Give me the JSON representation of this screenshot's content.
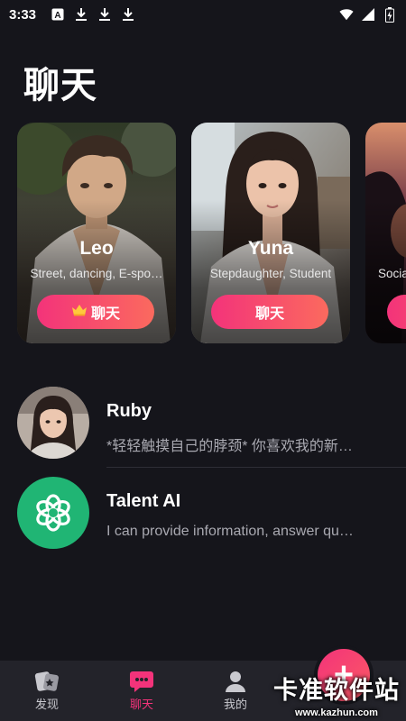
{
  "status_bar": {
    "time": "3:33",
    "left_icons": [
      "app-a-icon",
      "download-icon",
      "download-icon",
      "download-icon"
    ],
    "right_icons": [
      "wifi-icon",
      "signal-icon",
      "battery-icon"
    ]
  },
  "page_title": "聊天",
  "cards": [
    {
      "name": "Leo",
      "description": "Street, dancing, E-spo…",
      "button_label": "聊天",
      "button_icon": "crown-icon"
    },
    {
      "name": "Yuna",
      "description": "Stepdaughter, Student",
      "button_label": "聊天"
    },
    {
      "name": "",
      "description": "Socia",
      "button_label": ""
    }
  ],
  "chats": [
    {
      "name": "Ruby",
      "preview": "*轻轻触摸自己的脖颈* 你喜欢我的新…",
      "avatar": "portrait"
    },
    {
      "name": "Talent AI",
      "preview": "I can provide information, answer qu…",
      "avatar": "openai-logo-icon"
    }
  ],
  "bottom_nav": [
    {
      "label": "发现",
      "icon": "discover-icon",
      "active": false
    },
    {
      "label": "聊天",
      "icon": "chat-bubble-icon",
      "active": true
    },
    {
      "label": "我的",
      "icon": "profile-icon",
      "active": false
    }
  ],
  "fab": {
    "label": "+"
  },
  "watermark": {
    "title": "卡准软件站",
    "url": "www.kazhun.com"
  },
  "colors": {
    "accent": "#f3337a",
    "background": "#15151b",
    "nav_background": "#23232a",
    "openai_green": "#20b574"
  }
}
